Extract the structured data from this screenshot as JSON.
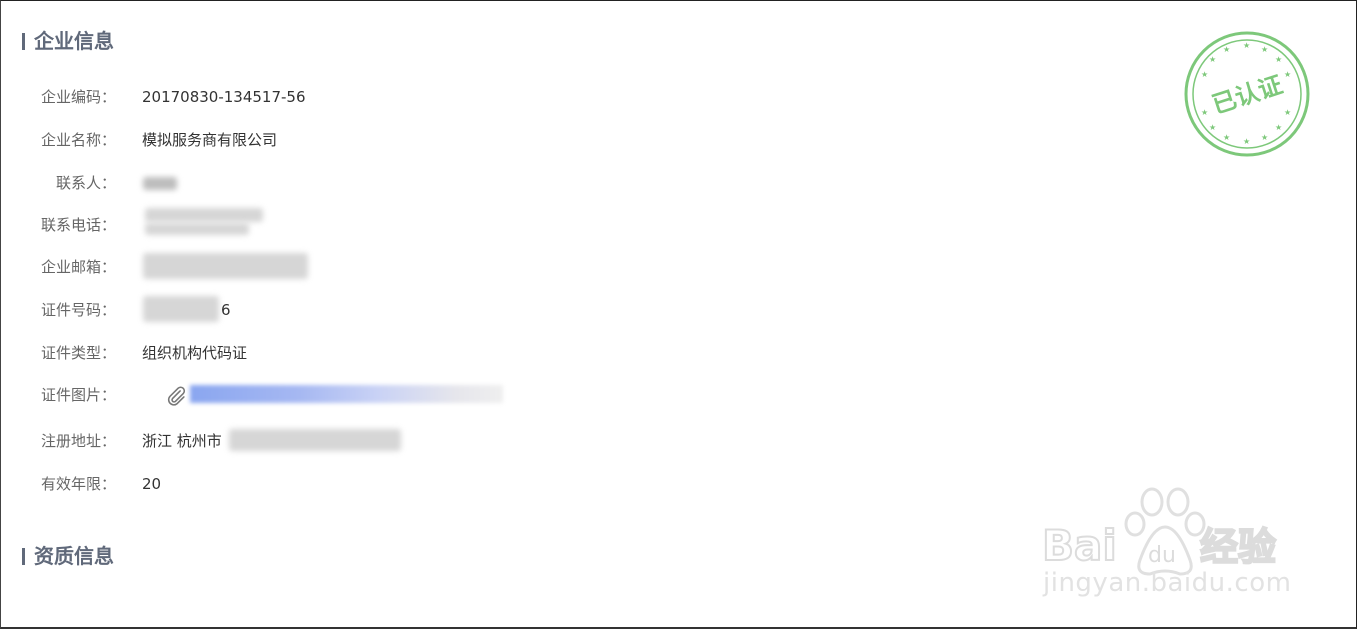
{
  "sections": {
    "enterprise_info": "企业信息",
    "qualification_info": "资质信息"
  },
  "fields": {
    "code": {
      "label": "企业编码：",
      "value": "20170830-134517-56"
    },
    "name": {
      "label": "企业名称：",
      "value": "模拟服务商有限公司"
    },
    "contact": {
      "label": "联系人：",
      "value": ""
    },
    "phone": {
      "label": "联系电话：",
      "value": ""
    },
    "email": {
      "label": "企业邮箱：",
      "value": ""
    },
    "id_number": {
      "label": "证件号码：",
      "value": "6"
    },
    "id_type": {
      "label": "证件类型：",
      "value": "组织机构代码证"
    },
    "id_image": {
      "label": "证件图片：",
      "value": ""
    },
    "address": {
      "label": "注册地址：",
      "value": "浙江 杭州市"
    },
    "validity": {
      "label": "有效年限：",
      "value": "20"
    }
  },
  "stamp": {
    "text": "已认证",
    "color": "#7dc87a"
  },
  "watermark": {
    "text": "jingyan.baidu.com",
    "logo": "Baidu经验"
  },
  "colors": {
    "section_title": "#60697a",
    "label": "#666666",
    "value": "#333333"
  }
}
